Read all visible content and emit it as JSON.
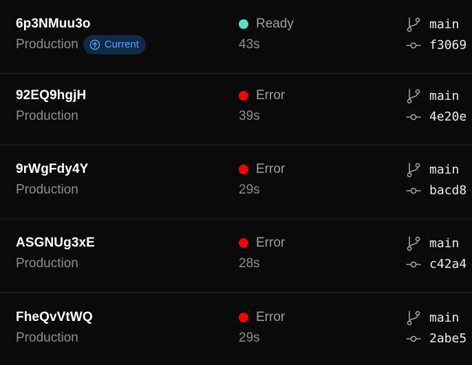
{
  "colors": {
    "ready": "#50e3c2",
    "error": "#ff0000",
    "accent": "#52a8ff",
    "badge_bg": "#0f2a46"
  },
  "deployments": [
    {
      "id": "6p3NMuu3o",
      "environment": "Production",
      "current_badge": "Current",
      "status": "Ready",
      "status_color": "#50e3c2",
      "duration": "43s",
      "branch": "main",
      "commit": "f3069"
    },
    {
      "id": "92EQ9hgjH",
      "environment": "Production",
      "status": "Error",
      "status_color": "#ff0000",
      "duration": "39s",
      "branch": "main",
      "commit": "4e20e"
    },
    {
      "id": "9rWgFdy4Y",
      "environment": "Production",
      "status": "Error",
      "status_color": "#ff0000",
      "duration": "29s",
      "branch": "main",
      "commit": "bacd8"
    },
    {
      "id": "ASGNUg3xE",
      "environment": "Production",
      "status": "Error",
      "status_color": "#ff0000",
      "duration": "28s",
      "branch": "main",
      "commit": "c42a4"
    },
    {
      "id": "FheQvVtWQ",
      "environment": "Production",
      "status": "Error",
      "status_color": "#ff0000",
      "duration": "29s",
      "branch": "main",
      "commit": "2abe5"
    }
  ]
}
